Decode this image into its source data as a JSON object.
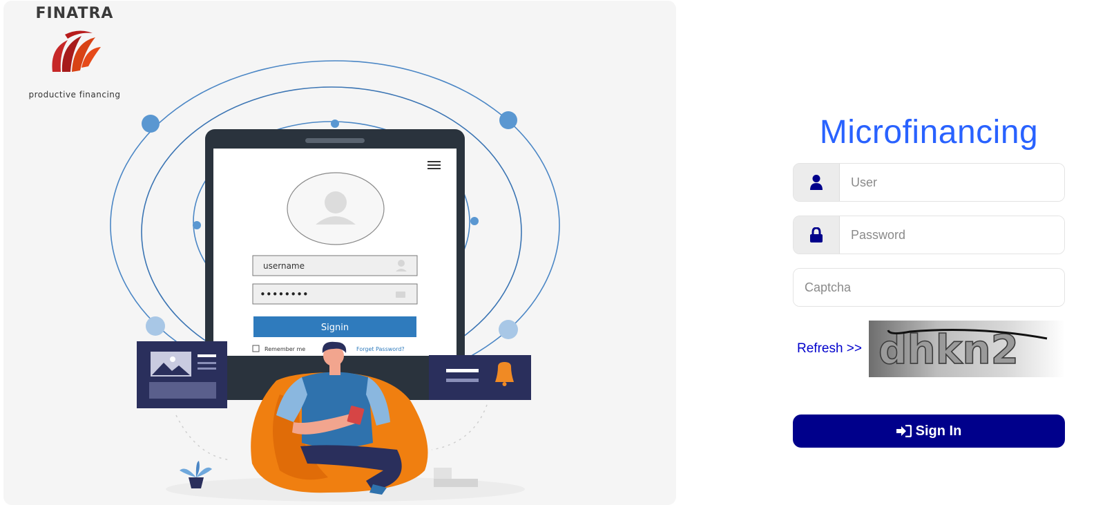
{
  "brand": {
    "name": "FINATRA",
    "tagline": "productive financing"
  },
  "illustration": {
    "username_value": "username",
    "password_dots": "••••••••",
    "signin_label": "Signin",
    "remember_label": "Remember me",
    "forgot_label": "Forget Password?"
  },
  "form": {
    "title": "Microfinancing",
    "user_placeholder": "User",
    "password_placeholder": "Password",
    "captcha_placeholder": "Captcha",
    "refresh_label": "Refresh >>",
    "captcha_text": "dhkn2",
    "signin_label": "Sign In"
  },
  "colors": {
    "title": "#2962ff",
    "button": "#00008b",
    "icon": "#00008b",
    "link": "#0000cc"
  },
  "icons": {
    "user_addon": "user-icon",
    "password_addon": "lock-icon",
    "signin": "sign-in-icon"
  }
}
